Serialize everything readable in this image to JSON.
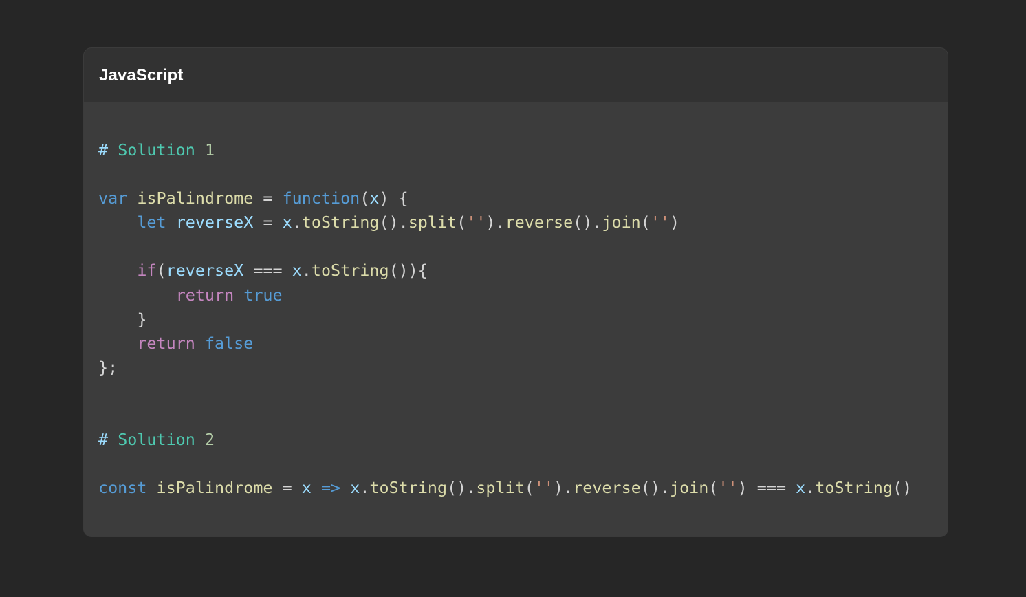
{
  "header": {
    "language": "JavaScript"
  },
  "colors": {
    "background": "#262626",
    "card_header": "#323232",
    "card_body": "#3c3c3c",
    "hash": "#9cdcfe",
    "heading": "#4ec9b0",
    "number": "#b5cea8",
    "keyword": "#569cd6",
    "control": "#c586c0",
    "function": "#dcdcaa",
    "variable": "#9cdcfe",
    "string": "#ce9178",
    "plain": "#d4d4d4"
  },
  "code": {
    "lines": [
      [
        [
          "hash",
          "#"
        ],
        [
          "plain",
          " "
        ],
        [
          "heading",
          "Solution"
        ],
        [
          "plain",
          " "
        ],
        [
          "number",
          "1"
        ]
      ],
      [],
      [
        [
          "keyword",
          "var"
        ],
        [
          "plain",
          " "
        ],
        [
          "function",
          "isPalindrome"
        ],
        [
          "plain",
          " = "
        ],
        [
          "keyword",
          "function"
        ],
        [
          "plain",
          "("
        ],
        [
          "variable",
          "x"
        ],
        [
          "plain",
          ") {"
        ]
      ],
      [
        [
          "plain",
          "    "
        ],
        [
          "keyword",
          "let"
        ],
        [
          "plain",
          " "
        ],
        [
          "variable",
          "reverseX"
        ],
        [
          "plain",
          " = "
        ],
        [
          "variable",
          "x"
        ],
        [
          "plain",
          "."
        ],
        [
          "function",
          "toString"
        ],
        [
          "plain",
          "()."
        ],
        [
          "function",
          "split"
        ],
        [
          "plain",
          "("
        ],
        [
          "string",
          "''"
        ],
        [
          "plain",
          ")."
        ],
        [
          "function",
          "reverse"
        ],
        [
          "plain",
          "()."
        ],
        [
          "function",
          "join"
        ],
        [
          "plain",
          "("
        ],
        [
          "string",
          "''"
        ],
        [
          "plain",
          ")"
        ]
      ],
      [],
      [
        [
          "plain",
          "    "
        ],
        [
          "control",
          "if"
        ],
        [
          "plain",
          "("
        ],
        [
          "variable",
          "reverseX"
        ],
        [
          "plain",
          " === "
        ],
        [
          "variable",
          "x"
        ],
        [
          "plain",
          "."
        ],
        [
          "function",
          "toString"
        ],
        [
          "plain",
          "()){"
        ]
      ],
      [
        [
          "plain",
          "        "
        ],
        [
          "control",
          "return"
        ],
        [
          "plain",
          " "
        ],
        [
          "keyword",
          "true"
        ]
      ],
      [
        [
          "plain",
          "    }"
        ]
      ],
      [
        [
          "plain",
          "    "
        ],
        [
          "control",
          "return"
        ],
        [
          "plain",
          " "
        ],
        [
          "keyword",
          "false"
        ]
      ],
      [
        [
          "plain",
          "};"
        ]
      ],
      [],
      [],
      [
        [
          "hash",
          "#"
        ],
        [
          "plain",
          " "
        ],
        [
          "heading",
          "Solution"
        ],
        [
          "plain",
          " "
        ],
        [
          "number",
          "2"
        ]
      ],
      [],
      [
        [
          "keyword",
          "const"
        ],
        [
          "plain",
          " "
        ],
        [
          "function",
          "isPalindrome"
        ],
        [
          "plain",
          " = "
        ],
        [
          "variable",
          "x"
        ],
        [
          "plain",
          " "
        ],
        [
          "keyword",
          "=>"
        ],
        [
          "plain",
          " "
        ],
        [
          "variable",
          "x"
        ],
        [
          "plain",
          "."
        ],
        [
          "function",
          "toString"
        ],
        [
          "plain",
          "()."
        ],
        [
          "function",
          "split"
        ],
        [
          "plain",
          "("
        ],
        [
          "string",
          "''"
        ],
        [
          "plain",
          ")."
        ],
        [
          "function",
          "reverse"
        ],
        [
          "plain",
          "()."
        ],
        [
          "function",
          "join"
        ],
        [
          "plain",
          "("
        ],
        [
          "string",
          "''"
        ],
        [
          "plain",
          ") === "
        ],
        [
          "variable",
          "x"
        ],
        [
          "plain",
          "."
        ],
        [
          "function",
          "toString"
        ],
        [
          "plain",
          "()"
        ]
      ]
    ]
  }
}
